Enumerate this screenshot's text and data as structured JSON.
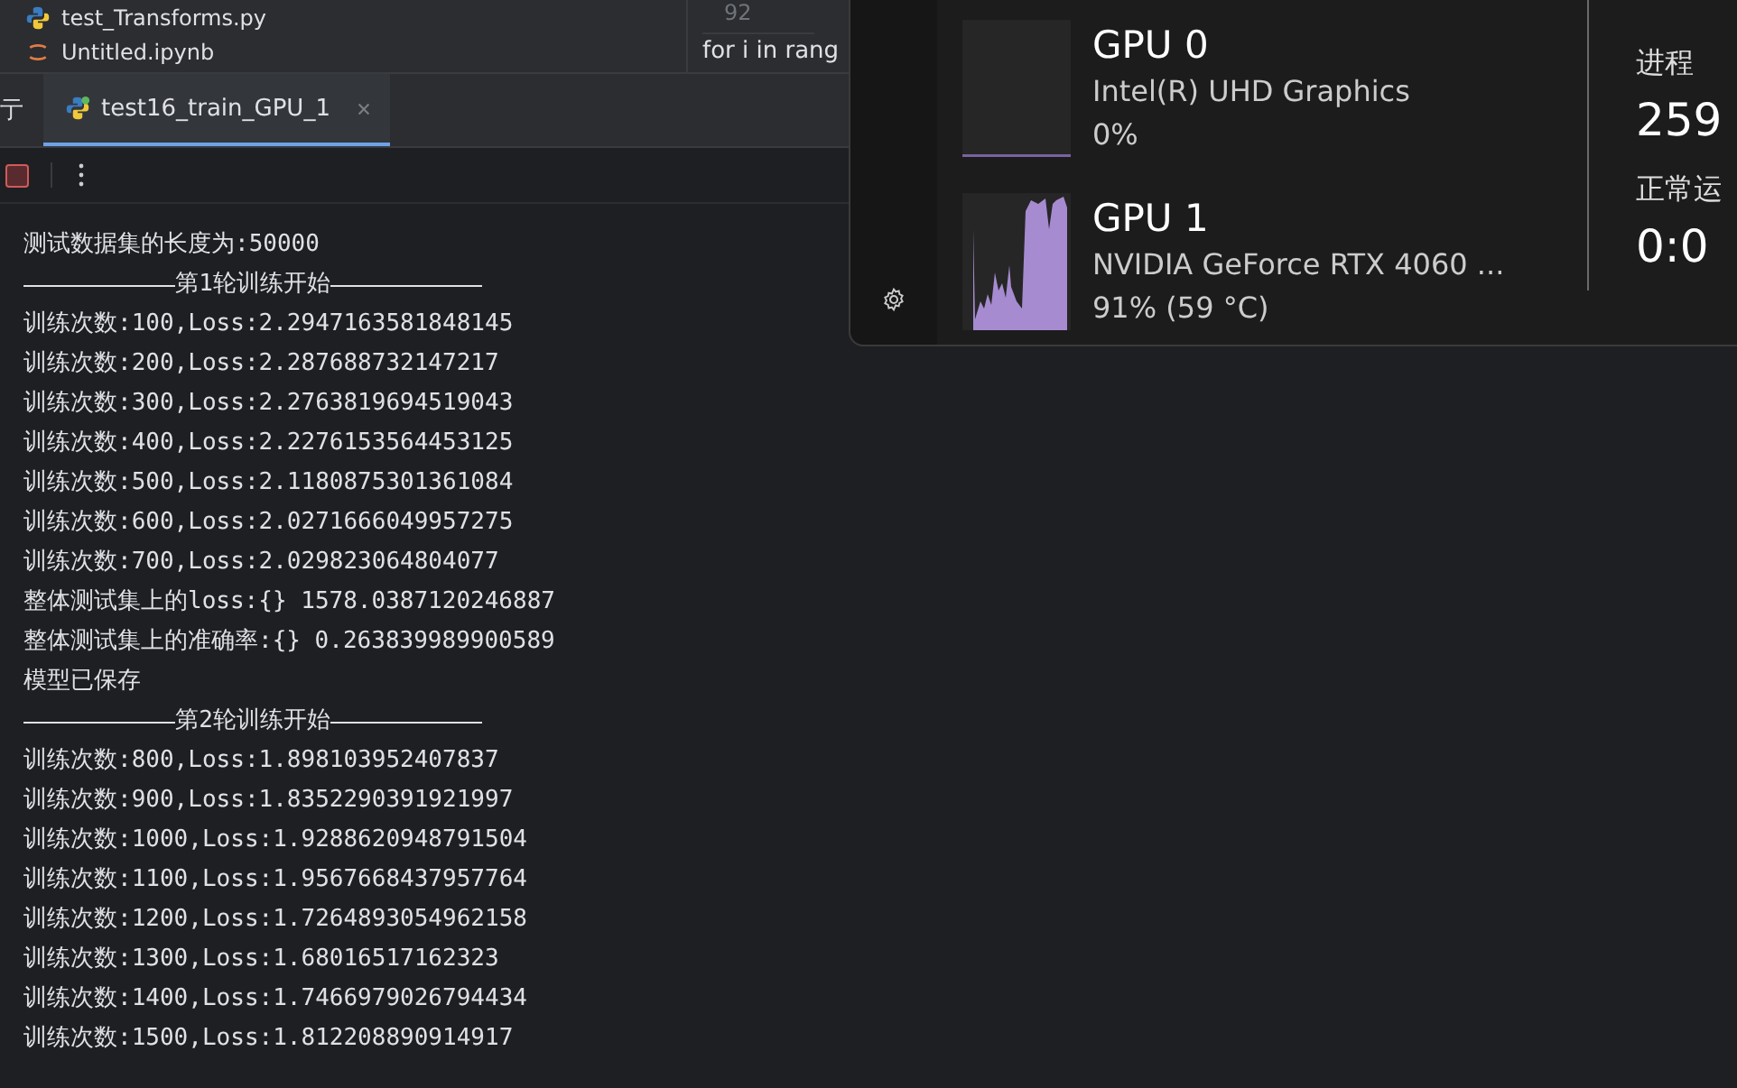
{
  "project_files": [
    {
      "name": "test_Transforms.py",
      "kind": "python"
    },
    {
      "name": "Untitled.ipynb",
      "kind": "notebook"
    }
  ],
  "editor": {
    "line_number": "92",
    "code": "for i in rang"
  },
  "run_panel": {
    "left_tab_fragment": "亍",
    "tabs": [
      {
        "label": "test16_train_GPU_1",
        "selected": true
      }
    ],
    "console_lines": [
      {
        "text": "测试数据集的长度为:50000",
        "kind": "plain"
      },
      {
        "text": "第1轮训练开始",
        "kind": "header"
      },
      {
        "text": "训练次数:100,Loss:2.2947163581848145",
        "kind": "plain"
      },
      {
        "text": "训练次数:200,Loss:2.287688732147217",
        "kind": "plain"
      },
      {
        "text": "训练次数:300,Loss:2.2763819694519043",
        "kind": "plain"
      },
      {
        "text": "训练次数:400,Loss:2.2276153564453125",
        "kind": "plain"
      },
      {
        "text": "训练次数:500,Loss:2.1180875301361084",
        "kind": "plain"
      },
      {
        "text": "训练次数:600,Loss:2.0271666049957275",
        "kind": "plain"
      },
      {
        "text": "训练次数:700,Loss:2.029823064804077",
        "kind": "plain"
      },
      {
        "text": "整体测试集上的loss:{} 1578.0387120246887",
        "kind": "plain"
      },
      {
        "text": "整体测试集上的准确率:{} 0.263839989900589",
        "kind": "plain"
      },
      {
        "text": "模型已保存",
        "kind": "plain"
      },
      {
        "text": "第2轮训练开始",
        "kind": "header"
      },
      {
        "text": "训练次数:800,Loss:1.898103952407837",
        "kind": "plain"
      },
      {
        "text": "训练次数:900,Loss:1.8352290391921997",
        "kind": "plain"
      },
      {
        "text": "训练次数:1000,Loss:1.9288620948791504",
        "kind": "plain"
      },
      {
        "text": "训练次数:1100,Loss:1.9567668437957764",
        "kind": "plain"
      },
      {
        "text": "训练次数:1200,Loss:1.7264893054962158",
        "kind": "plain"
      },
      {
        "text": "训练次数:1300,Loss:1.68016517162323",
        "kind": "plain"
      },
      {
        "text": "训练次数:1400,Loss:1.7466979026794434",
        "kind": "plain"
      },
      {
        "text": "训练次数:1500,Loss:1.812208890914917",
        "kind": "plain"
      }
    ]
  },
  "task_manager": {
    "gpus": [
      {
        "name": "GPU 0",
        "model": "Intel(R) UHD Graphics",
        "usage": "0%",
        "kind": "idle"
      },
      {
        "name": "GPU 1",
        "model": "NVIDIA GeForce RTX 4060 ...",
        "usage": "91% (59 °C)",
        "kind": "busy"
      }
    ],
    "stats": [
      {
        "label": "进程",
        "value": "259"
      },
      {
        "label": "正常运",
        "value": "0:0"
      }
    ]
  }
}
